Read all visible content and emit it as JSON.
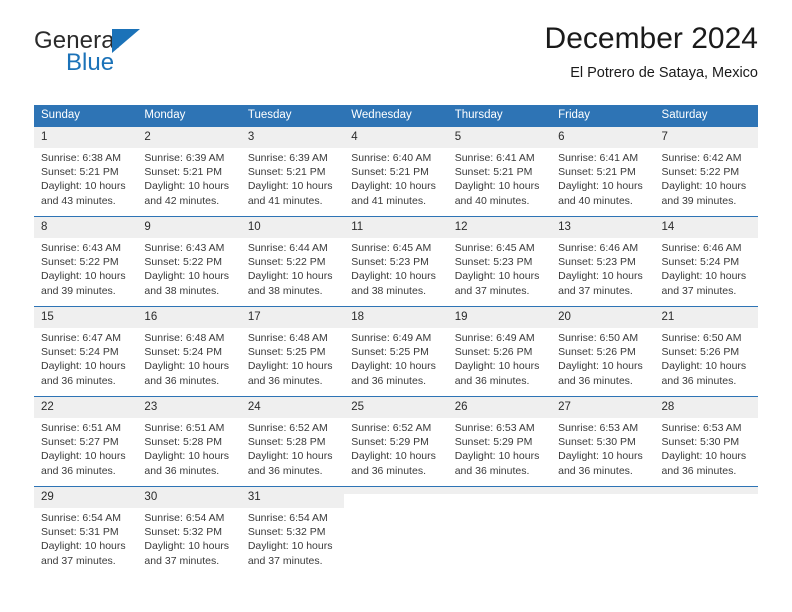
{
  "brand": {
    "word_one": "General",
    "word_two": "Blue",
    "flag_icon": "triangle-flag-icon",
    "accent_color": "#1b72b8"
  },
  "header": {
    "month_title": "December 2024",
    "location": "El Potrero de Sataya, Mexico"
  },
  "calendar": {
    "header_background": "#2e74b5",
    "daynum_background": "#efefef",
    "weekday_headers": [
      "Sunday",
      "Monday",
      "Tuesday",
      "Wednesday",
      "Thursday",
      "Friday",
      "Saturday"
    ],
    "weeks": [
      [
        {
          "day": "1",
          "sunrise": "Sunrise: 6:38 AM",
          "sunset": "Sunset: 5:21 PM",
          "daylight_1": "Daylight: 10 hours",
          "daylight_2": "and 43 minutes."
        },
        {
          "day": "2",
          "sunrise": "Sunrise: 6:39 AM",
          "sunset": "Sunset: 5:21 PM",
          "daylight_1": "Daylight: 10 hours",
          "daylight_2": "and 42 minutes."
        },
        {
          "day": "3",
          "sunrise": "Sunrise: 6:39 AM",
          "sunset": "Sunset: 5:21 PM",
          "daylight_1": "Daylight: 10 hours",
          "daylight_2": "and 41 minutes."
        },
        {
          "day": "4",
          "sunrise": "Sunrise: 6:40 AM",
          "sunset": "Sunset: 5:21 PM",
          "daylight_1": "Daylight: 10 hours",
          "daylight_2": "and 41 minutes."
        },
        {
          "day": "5",
          "sunrise": "Sunrise: 6:41 AM",
          "sunset": "Sunset: 5:21 PM",
          "daylight_1": "Daylight: 10 hours",
          "daylight_2": "and 40 minutes."
        },
        {
          "day": "6",
          "sunrise": "Sunrise: 6:41 AM",
          "sunset": "Sunset: 5:21 PM",
          "daylight_1": "Daylight: 10 hours",
          "daylight_2": "and 40 minutes."
        },
        {
          "day": "7",
          "sunrise": "Sunrise: 6:42 AM",
          "sunset": "Sunset: 5:22 PM",
          "daylight_1": "Daylight: 10 hours",
          "daylight_2": "and 39 minutes."
        }
      ],
      [
        {
          "day": "8",
          "sunrise": "Sunrise: 6:43 AM",
          "sunset": "Sunset: 5:22 PM",
          "daylight_1": "Daylight: 10 hours",
          "daylight_2": "and 39 minutes."
        },
        {
          "day": "9",
          "sunrise": "Sunrise: 6:43 AM",
          "sunset": "Sunset: 5:22 PM",
          "daylight_1": "Daylight: 10 hours",
          "daylight_2": "and 38 minutes."
        },
        {
          "day": "10",
          "sunrise": "Sunrise: 6:44 AM",
          "sunset": "Sunset: 5:22 PM",
          "daylight_1": "Daylight: 10 hours",
          "daylight_2": "and 38 minutes."
        },
        {
          "day": "11",
          "sunrise": "Sunrise: 6:45 AM",
          "sunset": "Sunset: 5:23 PM",
          "daylight_1": "Daylight: 10 hours",
          "daylight_2": "and 38 minutes."
        },
        {
          "day": "12",
          "sunrise": "Sunrise: 6:45 AM",
          "sunset": "Sunset: 5:23 PM",
          "daylight_1": "Daylight: 10 hours",
          "daylight_2": "and 37 minutes."
        },
        {
          "day": "13",
          "sunrise": "Sunrise: 6:46 AM",
          "sunset": "Sunset: 5:23 PM",
          "daylight_1": "Daylight: 10 hours",
          "daylight_2": "and 37 minutes."
        },
        {
          "day": "14",
          "sunrise": "Sunrise: 6:46 AM",
          "sunset": "Sunset: 5:24 PM",
          "daylight_1": "Daylight: 10 hours",
          "daylight_2": "and 37 minutes."
        }
      ],
      [
        {
          "day": "15",
          "sunrise": "Sunrise: 6:47 AM",
          "sunset": "Sunset: 5:24 PM",
          "daylight_1": "Daylight: 10 hours",
          "daylight_2": "and 36 minutes."
        },
        {
          "day": "16",
          "sunrise": "Sunrise: 6:48 AM",
          "sunset": "Sunset: 5:24 PM",
          "daylight_1": "Daylight: 10 hours",
          "daylight_2": "and 36 minutes."
        },
        {
          "day": "17",
          "sunrise": "Sunrise: 6:48 AM",
          "sunset": "Sunset: 5:25 PM",
          "daylight_1": "Daylight: 10 hours",
          "daylight_2": "and 36 minutes."
        },
        {
          "day": "18",
          "sunrise": "Sunrise: 6:49 AM",
          "sunset": "Sunset: 5:25 PM",
          "daylight_1": "Daylight: 10 hours",
          "daylight_2": "and 36 minutes."
        },
        {
          "day": "19",
          "sunrise": "Sunrise: 6:49 AM",
          "sunset": "Sunset: 5:26 PM",
          "daylight_1": "Daylight: 10 hours",
          "daylight_2": "and 36 minutes."
        },
        {
          "day": "20",
          "sunrise": "Sunrise: 6:50 AM",
          "sunset": "Sunset: 5:26 PM",
          "daylight_1": "Daylight: 10 hours",
          "daylight_2": "and 36 minutes."
        },
        {
          "day": "21",
          "sunrise": "Sunrise: 6:50 AM",
          "sunset": "Sunset: 5:26 PM",
          "daylight_1": "Daylight: 10 hours",
          "daylight_2": "and 36 minutes."
        }
      ],
      [
        {
          "day": "22",
          "sunrise": "Sunrise: 6:51 AM",
          "sunset": "Sunset: 5:27 PM",
          "daylight_1": "Daylight: 10 hours",
          "daylight_2": "and 36 minutes."
        },
        {
          "day": "23",
          "sunrise": "Sunrise: 6:51 AM",
          "sunset": "Sunset: 5:28 PM",
          "daylight_1": "Daylight: 10 hours",
          "daylight_2": "and 36 minutes."
        },
        {
          "day": "24",
          "sunrise": "Sunrise: 6:52 AM",
          "sunset": "Sunset: 5:28 PM",
          "daylight_1": "Daylight: 10 hours",
          "daylight_2": "and 36 minutes."
        },
        {
          "day": "25",
          "sunrise": "Sunrise: 6:52 AM",
          "sunset": "Sunset: 5:29 PM",
          "daylight_1": "Daylight: 10 hours",
          "daylight_2": "and 36 minutes."
        },
        {
          "day": "26",
          "sunrise": "Sunrise: 6:53 AM",
          "sunset": "Sunset: 5:29 PM",
          "daylight_1": "Daylight: 10 hours",
          "daylight_2": "and 36 minutes."
        },
        {
          "day": "27",
          "sunrise": "Sunrise: 6:53 AM",
          "sunset": "Sunset: 5:30 PM",
          "daylight_1": "Daylight: 10 hours",
          "daylight_2": "and 36 minutes."
        },
        {
          "day": "28",
          "sunrise": "Sunrise: 6:53 AM",
          "sunset": "Sunset: 5:30 PM",
          "daylight_1": "Daylight: 10 hours",
          "daylight_2": "and 36 minutes."
        }
      ],
      [
        {
          "day": "29",
          "sunrise": "Sunrise: 6:54 AM",
          "sunset": "Sunset: 5:31 PM",
          "daylight_1": "Daylight: 10 hours",
          "daylight_2": "and 37 minutes."
        },
        {
          "day": "30",
          "sunrise": "Sunrise: 6:54 AM",
          "sunset": "Sunset: 5:32 PM",
          "daylight_1": "Daylight: 10 hours",
          "daylight_2": "and 37 minutes."
        },
        {
          "day": "31",
          "sunrise": "Sunrise: 6:54 AM",
          "sunset": "Sunset: 5:32 PM",
          "daylight_1": "Daylight: 10 hours",
          "daylight_2": "and 37 minutes."
        },
        {
          "day": "",
          "sunrise": "",
          "sunset": "",
          "daylight_1": "",
          "daylight_2": ""
        },
        {
          "day": "",
          "sunrise": "",
          "sunset": "",
          "daylight_1": "",
          "daylight_2": ""
        },
        {
          "day": "",
          "sunrise": "",
          "sunset": "",
          "daylight_1": "",
          "daylight_2": ""
        },
        {
          "day": "",
          "sunrise": "",
          "sunset": "",
          "daylight_1": "",
          "daylight_2": ""
        }
      ]
    ]
  }
}
